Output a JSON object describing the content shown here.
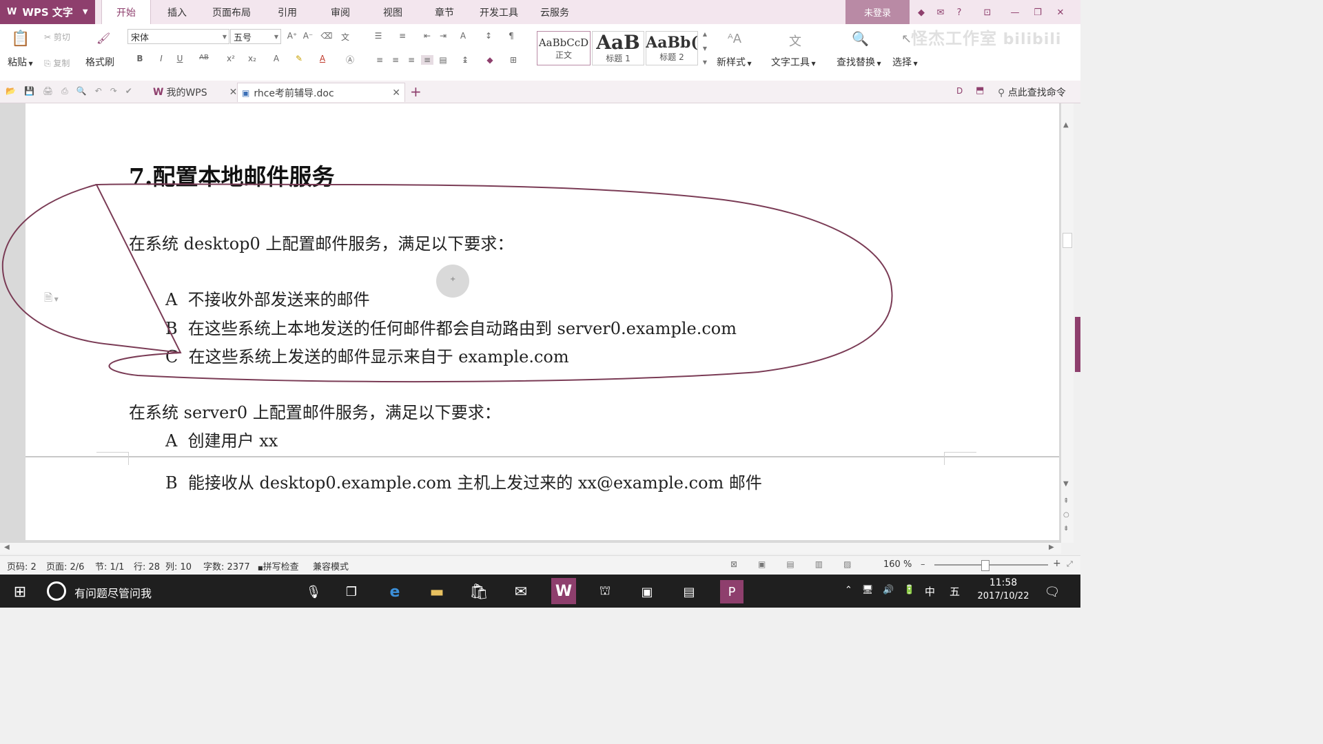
{
  "app": {
    "name": "WPS 文字"
  },
  "menu_tabs": [
    "开始",
    "插入",
    "页面布局",
    "引用",
    "审阅",
    "视图",
    "章节",
    "开发工具",
    "云服务"
  ],
  "login_label": "未登录",
  "watermark": "怪杰工作室",
  "ribbon": {
    "paste": "粘贴",
    "cut": "剪切",
    "copy": "复制",
    "format_painter": "格式刷",
    "font_name": "宋体",
    "font_size": "五号",
    "styles": [
      {
        "preview": "AaBbCcD",
        "name": "正文"
      },
      {
        "preview": "AaB",
        "name": "标题 1"
      },
      {
        "preview": "AaBb(",
        "name": "标题 2"
      }
    ],
    "new_style": "新样式",
    "text_tools": "文字工具",
    "find_replace": "查找替换",
    "select": "选择"
  },
  "doc_tabs": [
    {
      "label": "我的WPS",
      "icon": "wps-logo-icon"
    },
    {
      "label": "rhce考前辅导.doc",
      "icon": "doc-file-icon"
    }
  ],
  "search_command": "点此查找命令",
  "document": {
    "heading": "7.配置本地邮件服务",
    "para1": "在系统 desktop0 上配置邮件服务，满足以下要求：",
    "items1": [
      {
        "letter": "A",
        "text": "不接收外部发送来的邮件"
      },
      {
        "letter": "B",
        "text": "在这些系统上本地发送的任何邮件都会自动路由到 server0.example.com"
      },
      {
        "letter": "C",
        "text": "在这些系统上发送的邮件显示来自于 example.com"
      }
    ],
    "para2": "在系统 server0 上配置邮件服务，满足以下要求：",
    "items2": [
      {
        "letter": "A",
        "text": "创建用户 xx"
      },
      {
        "letter": "B",
        "text": "能接收从 desktop0.example.com 主机上发过来的 xx@example.com 邮件"
      }
    ]
  },
  "status": {
    "page_num": "页码: 2",
    "pages": "页面: 2/6",
    "section": "节: 1/1",
    "row": "行: 28",
    "col": "列: 10",
    "words": "字数: 2377",
    "spell": "拼写检查",
    "compat": "兼容模式",
    "zoom": "160 %",
    "zoom_level": 0.44
  },
  "taskbar": {
    "search": "有问题尽管问我",
    "ime1": "中",
    "ime2": "五",
    "time": "11:58",
    "date": "2017/10/22"
  },
  "colors": {
    "accent": "#8e3f6d",
    "annotation": "#7a3b55",
    "taskbar": "#1f1f1f"
  }
}
